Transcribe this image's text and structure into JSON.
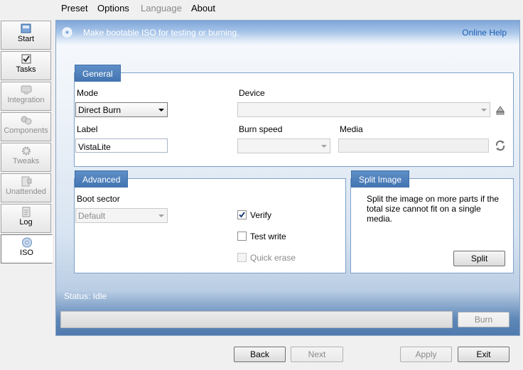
{
  "menu": {
    "preset": "Preset",
    "options": "Options",
    "language": "Language",
    "about": "About"
  },
  "sidebar": {
    "items": [
      {
        "label": "Start",
        "icon": "start-icon",
        "state": "enabled"
      },
      {
        "label": "Tasks",
        "icon": "tasks-icon",
        "state": "enabled"
      },
      {
        "label": "Integration",
        "icon": "integration-icon",
        "state": "disabled"
      },
      {
        "label": "Components",
        "icon": "components-icon",
        "state": "disabled"
      },
      {
        "label": "Tweaks",
        "icon": "tweaks-icon",
        "state": "disabled"
      },
      {
        "label": "Unattended",
        "icon": "unattended-icon",
        "state": "disabled"
      },
      {
        "label": "Log",
        "icon": "log-icon",
        "state": "enabled"
      },
      {
        "label": "ISO",
        "icon": "iso-icon",
        "state": "active"
      }
    ]
  },
  "header": {
    "text": "Make bootable ISO for testing or burning.",
    "help_link": "Online Help"
  },
  "general": {
    "title": "General",
    "mode_label": "Mode",
    "mode_value": "Direct Burn",
    "device_label": "Device",
    "device_value": "",
    "label_label": "Label",
    "label_value": "VistaLite",
    "burn_speed_label": "Burn speed",
    "burn_speed_value": "",
    "media_label": "Media",
    "media_value": ""
  },
  "advanced": {
    "title": "Advanced",
    "boot_sector_label": "Boot sector",
    "boot_sector_value": "Default",
    "verify_label": "Verify",
    "verify_checked": true,
    "test_write_label": "Test write",
    "test_write_checked": false,
    "quick_erase_label": "Quick erase",
    "quick_erase_checked": false
  },
  "split": {
    "title": "Split Image",
    "description": "Split the image on more parts if the total size cannot fit on a single media.",
    "button": "Split"
  },
  "status": {
    "text": "Status: Idle",
    "progress_percent": 0,
    "burn_button": "Burn"
  },
  "footer": {
    "back": "Back",
    "next": "Next",
    "apply": "Apply",
    "exit": "Exit"
  },
  "colors": {
    "accent": "#4a78b3",
    "link": "#1a5fb4",
    "header_start": "#7ea6d8",
    "disabled_text": "#8a8a8a"
  }
}
